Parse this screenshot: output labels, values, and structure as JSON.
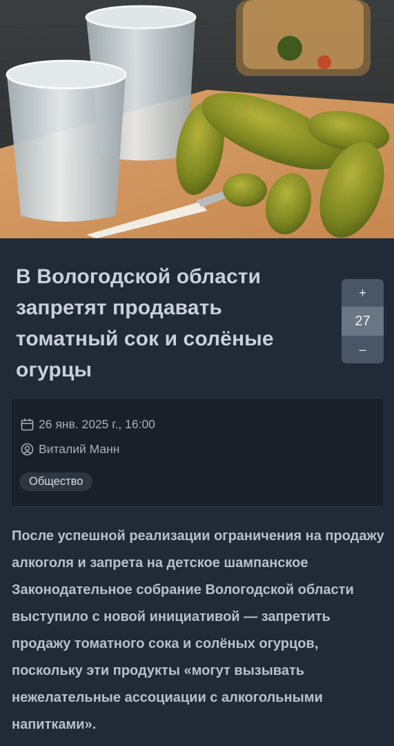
{
  "article": {
    "title": "В Вологодской области запретят продавать томатный сок и солёные огурцы",
    "date": "26 янв. 2025 г., 16:00",
    "author": "Виталий Манн",
    "category": "Общество",
    "body": "После успешной реализации ограничения на продажу алкоголя и запрета на детское шампанское Законодательное собрание Вологодской области выступило с новой инициативой — запретить продажу томатного сока и солёных огурцов, поскольку эти продукты «могут вызывать нежелательные ассоциации с алкогольными напитками»."
  },
  "vote": {
    "plus_label": "+",
    "count": "27",
    "minus_label": "–"
  },
  "icons": {
    "date": "calendar-icon",
    "author": "user-circle-icon"
  },
  "colors": {
    "background": "#212b38",
    "meta_background": "#1a2029",
    "vote_button": "#4a5665",
    "vote_count": "#6b7685"
  }
}
